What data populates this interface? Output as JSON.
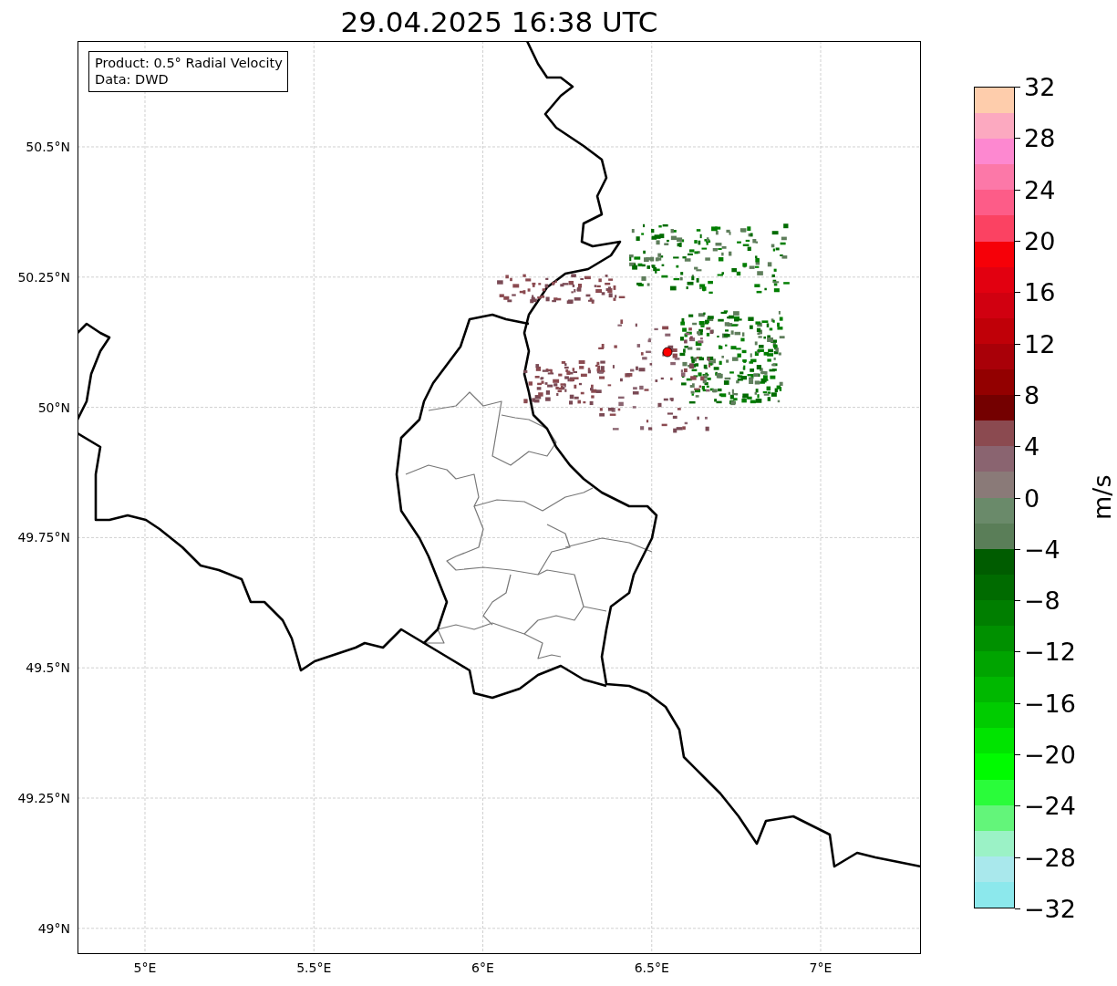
{
  "title": "29.04.2025 16:38 UTC",
  "legend": [
    "Product: 0.5° Radial Velocity",
    "Data: DWD"
  ],
  "map": {
    "lat_labels": [
      "50.5°N",
      "50.25°N",
      "50°N",
      "49.75°N",
      "49.5°N",
      "49.25°N",
      "49°N"
    ],
    "lon_labels": [
      "5°E",
      "5.5°E",
      "6°E",
      "6.5°E",
      "7°E"
    ]
  },
  "colorbar": {
    "label": "m/s",
    "ticks": [
      "32",
      "28",
      "24",
      "20",
      "16",
      "12",
      "8",
      "4",
      "0",
      "−4",
      "−8",
      "−12",
      "−16",
      "−20",
      "−24",
      "−28",
      "−32"
    ],
    "bins": [
      {
        "color": "#fecdac"
      },
      {
        "color": "#fca9c0"
      },
      {
        "color": "#fd88d0"
      },
      {
        "color": "#fc78a8"
      },
      {
        "color": "#fd5c88"
      },
      {
        "color": "#fb4262"
      },
      {
        "color": "#f60008"
      },
      {
        "color": "#e20010"
      },
      {
        "color": "#d10010"
      },
      {
        "color": "#c00008"
      },
      {
        "color": "#a90008"
      },
      {
        "color": "#930000"
      },
      {
        "color": "#740000"
      },
      {
        "color": "#8b4a50"
      },
      {
        "color": "#8a6470"
      },
      {
        "color": "#8a7a78"
      },
      {
        "color": "#6a8a6a"
      },
      {
        "color": "#5a7e58"
      },
      {
        "color": "#005c00"
      },
      {
        "color": "#006b00"
      },
      {
        "color": "#007e00"
      },
      {
        "color": "#009000"
      },
      {
        "color": "#00a400"
      },
      {
        "color": "#00b800"
      },
      {
        "color": "#00cc00"
      },
      {
        "color": "#00e400"
      },
      {
        "color": "#00fb00"
      },
      {
        "color": "#2afc3a"
      },
      {
        "color": "#63f57a"
      },
      {
        "color": "#9bf2c6"
      },
      {
        "color": "#a9e8ec"
      },
      {
        "color": "#8ce8ec"
      }
    ]
  }
}
